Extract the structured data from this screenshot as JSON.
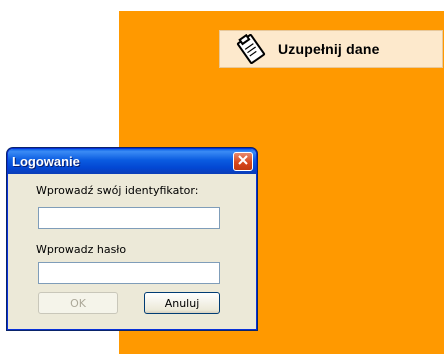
{
  "fill_data_button": {
    "label": "Uzupełnij dane",
    "icon": "clipboard-icon"
  },
  "login_dialog": {
    "title": "Logowanie",
    "id_label": "Wprowadź swój identyfikator:",
    "id_value": "",
    "password_label": "Wprowadz hasło",
    "password_value": "",
    "ok_label": "OK",
    "cancel_label": "Anuluj"
  },
  "colors": {
    "background_panel": "#ff9900",
    "titlebar": "#0a5be0",
    "dialog_body": "#ece9d8"
  }
}
